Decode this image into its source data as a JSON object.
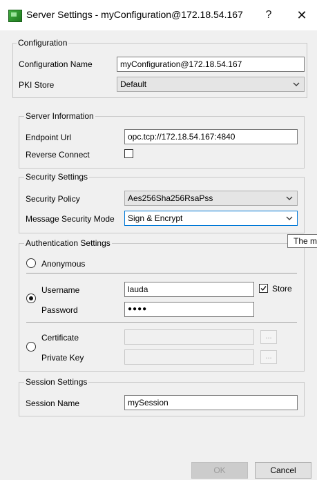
{
  "window": {
    "title": "Server Settings - myConfiguration@172.18.54.167",
    "help_label": "?",
    "close_label": "✕"
  },
  "configuration": {
    "title": "Configuration",
    "name_label": "Configuration Name",
    "name_value": "myConfiguration@172.18.54.167",
    "pki_label": "PKI Store",
    "pki_value": "Default"
  },
  "server_info": {
    "title": "Server Information",
    "endpoint_label": "Endpoint Url",
    "endpoint_value": "opc.tcp://172.18.54.167:4840",
    "reverse_label": "Reverse Connect",
    "reverse_checked": false
  },
  "security": {
    "title": "Security Settings",
    "policy_label": "Security Policy",
    "policy_value": "Aes256Sha256RsaPss",
    "mode_label": "Message Security Mode",
    "mode_value": "Sign & Encrypt"
  },
  "tooltip": {
    "text": "The m"
  },
  "auth": {
    "title": "Authentication Settings",
    "anonymous_label": "Anonymous",
    "username_label": "Username",
    "username_value": "lauda",
    "store_label": "Store",
    "store_checked": true,
    "password_label": "Password",
    "password_value": "●●●●",
    "certificate_label": "Certificate",
    "private_key_label": "Private Key",
    "browse_label": "..."
  },
  "session": {
    "title": "Session Settings",
    "name_label": "Session Name",
    "name_value": "mySession"
  },
  "buttons": {
    "ok": "OK",
    "cancel": "Cancel"
  },
  "colors": {
    "accent": "#0078d7",
    "app_icon": "#2e9a2e"
  }
}
